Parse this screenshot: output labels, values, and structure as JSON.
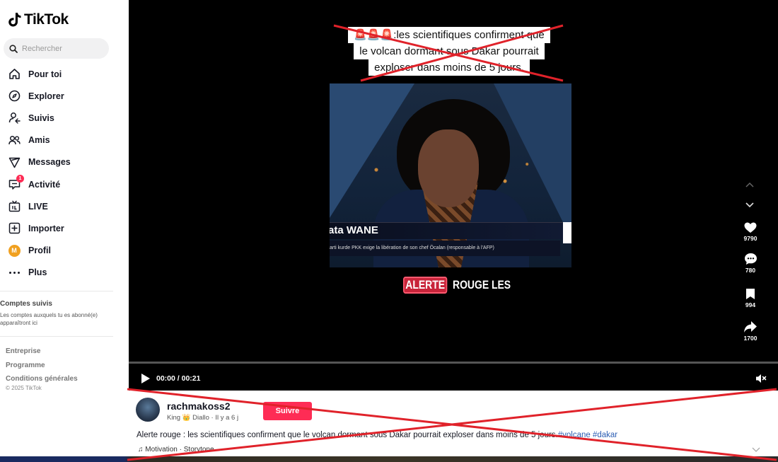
{
  "app": {
    "logo_text": "TikTok"
  },
  "search": {
    "placeholder": "Rechercher"
  },
  "nav": {
    "items": [
      {
        "label": "Pour toi",
        "icon": "home-icon"
      },
      {
        "label": "Explorer",
        "icon": "compass-icon"
      },
      {
        "label": "Suivis",
        "icon": "following-icon"
      },
      {
        "label": "Amis",
        "icon": "friends-icon"
      },
      {
        "label": "Messages",
        "icon": "messages-icon"
      },
      {
        "label": "Activité",
        "icon": "activity-icon",
        "badge": "1"
      },
      {
        "label": "LIVE",
        "icon": "live-icon"
      },
      {
        "label": "Importer",
        "icon": "upload-icon"
      },
      {
        "label": "Profil",
        "icon": "profile-avatar",
        "avatar_letter": "M"
      },
      {
        "label": "Plus",
        "icon": "more-icon"
      }
    ]
  },
  "followed": {
    "title": "Comptes suivis",
    "description": "Les comptes auxquels tu es abonné(e) apparaîtront ici"
  },
  "footer": {
    "links": [
      "Entreprise",
      "Programme",
      "Conditions générales"
    ],
    "copyright": "© 2025 TikTok"
  },
  "video": {
    "caption_lines": [
      "🚨🚨🚨:les scientifiques confirment que",
      "le volcan dormant sous Dakar pourrait",
      "exploser dans moins de 5 jours."
    ],
    "lower_third_name": "ata WANE",
    "lower_third_ticker": "arti kurde PKK exige la libération de son chef Öcalan (responsable à l'AFP)",
    "overlay_badge": "ALERTE",
    "overlay_text": "ROUGE LES",
    "time": "00:00 / 00:21",
    "progress": 0.0
  },
  "actions": {
    "likes": "9790",
    "comments": "780",
    "saves": "994",
    "shares": "1700"
  },
  "author": {
    "username": "rachmakoss2",
    "subline": "King 👑 Diallo · Il y a 6 j",
    "follow_label": "Suivre"
  },
  "post": {
    "description": "Alerte rouge : les scientifiques confirment que le volcan dormant sous Dakar pourrait exploser dans moins de 5 jours.",
    "hashtags": "#volcane #dakar",
    "music": "♫ Motivation · Storytone"
  },
  "colors": {
    "accent": "#fe2c55",
    "cross": "#e0222a"
  }
}
